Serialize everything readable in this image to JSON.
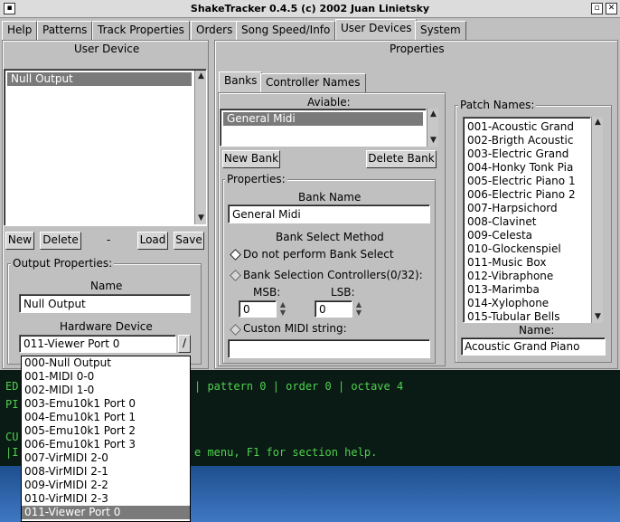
{
  "window": {
    "title": "ShakeTracker 0.4.5 (c) 2002 Juan Linietsky"
  },
  "tabs": [
    "Help",
    "Patterns",
    "Track Properties",
    "Orders",
    "Song Speed/Info",
    "User Devices",
    "System"
  ],
  "user_device": {
    "heading": "User Device",
    "list": [
      "Null Output"
    ],
    "buttons": {
      "new": "New",
      "delete": "Delete",
      "dash": "-",
      "load": "Load",
      "save": "Save"
    },
    "output_properties": {
      "legend": "Output Properties:",
      "name_label": "Name",
      "name_value": "Null Output",
      "hardware_label": "Hardware Device",
      "hardware_value": "011-Viewer Port 0",
      "hardware_button": "/"
    }
  },
  "properties": {
    "heading": "Properties",
    "subtabs": [
      "Banks",
      "Controller Names"
    ],
    "aviable_label": "Aviable:",
    "banks_list": [
      "General Midi"
    ],
    "new_bank": "New Bank",
    "delete_bank": "Delete Bank",
    "bank_props": {
      "legend": "Properties:",
      "bank_name_label": "Bank Name",
      "bank_name_value": "General Midi",
      "method_label": "Bank Select Method",
      "opt_none": "Do not perform Bank Select",
      "opt_controllers": "Bank Selection Controllers(0/32):",
      "msb_label": "MSB:",
      "msb_value": "0",
      "lsb_label": "LSB:",
      "lsb_value": "0",
      "opt_custom": "Custon MIDI string:",
      "custom_value": ""
    },
    "patch": {
      "legend": "Patch Names:",
      "items": [
        "001-Acoustic Grand",
        "002-Brigth Acoustic",
        "003-Electric Grand",
        "004-Honky Tonk Pia",
        "005-Electric Piano 1",
        "006-Electric Piano 2",
        "007-Harpsichord",
        "008-Clavinet",
        "009-Celesta",
        "010-Glockenspiel",
        "011-Music Box",
        "012-Vibraphone",
        "013-Marimba",
        "014-Xylophone",
        "015-Tubular Bells"
      ],
      "name_label": "Name:",
      "name_value": "Acoustic Grand Piano"
    }
  },
  "terminal": {
    "line1_left": "ED",
    "line1_right": "| pattern 0 | order 0 | octave 4",
    "line2": "PI",
    "line3": "CU",
    "line4_left": "|I",
    "line4_right": "e menu, F1 for section help."
  },
  "dropdown": {
    "items": [
      "000-Null Output",
      "001-MIDI 0-0",
      "002-MIDI 1-0",
      "003-Emu10k1 Port 0",
      "004-Emu10k1 Port 1",
      "005-Emu10k1 Port 2",
      "006-Emu10k1 Port 3",
      "007-VirMIDI 2-0",
      "008-VirMIDI 2-1",
      "009-VirMIDI 2-2",
      "010-VirMIDI 2-3",
      "011-Viewer Port 0"
    ],
    "selected": 11
  }
}
